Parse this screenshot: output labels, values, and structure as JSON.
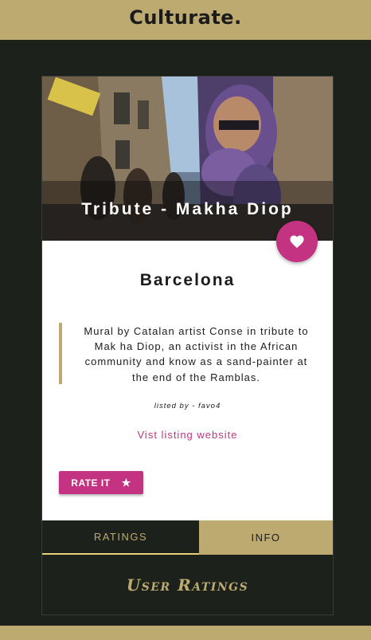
{
  "header": {
    "brand": "Culturate."
  },
  "listing": {
    "title": "Tribute - Makha Diop",
    "city": "Barcelona",
    "description": "Mural by Catalan artist Conse in tribute to Mak ha Diop, an activist in the African community and know as a sand-painter at the end of the Ramblas.",
    "listed_by": "listed by - favo4",
    "website_link": "Vist listing website",
    "rate_label": "RATE IT",
    "rate_icon": "star-icon",
    "favorite_icon": "heart-icon"
  },
  "tabs": [
    {
      "label": "RATINGS",
      "active": true
    },
    {
      "label": "INFO",
      "active": false
    }
  ],
  "ratings_panel": {
    "title": "User Ratings"
  },
  "colors": {
    "background": "#1d211b",
    "gold": "#bcaa71",
    "accent": "#c43381",
    "card": "#ffffff"
  }
}
